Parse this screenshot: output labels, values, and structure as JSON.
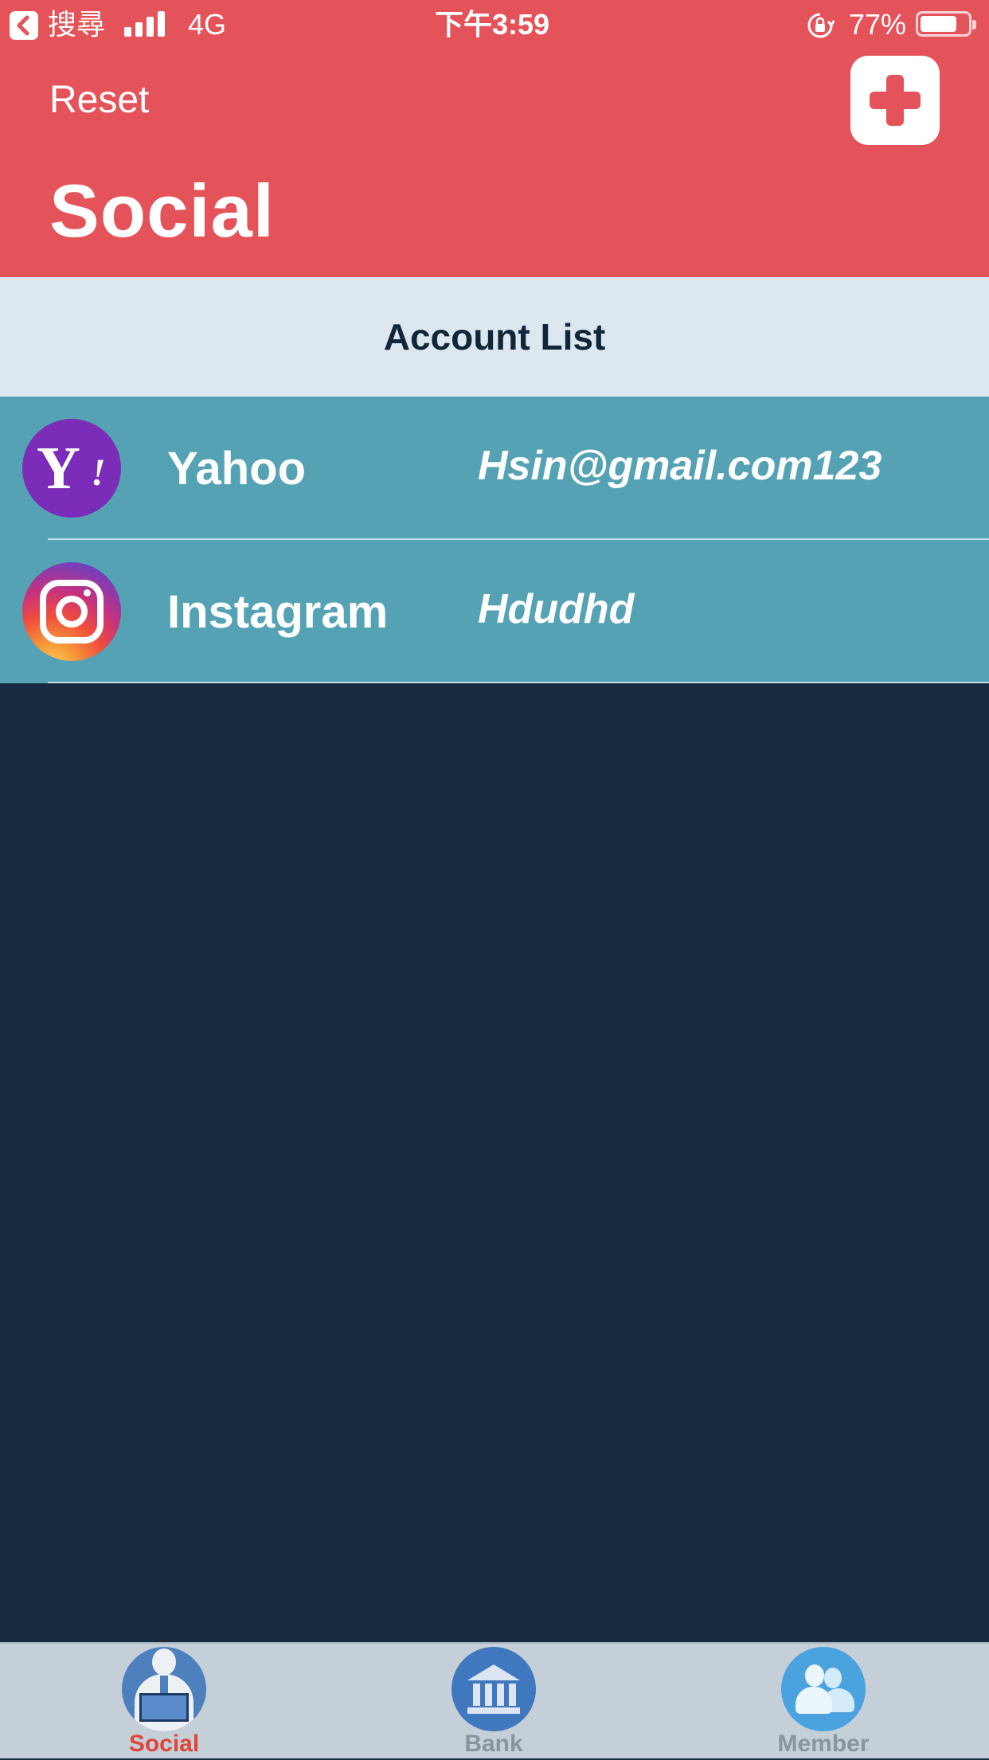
{
  "status_bar": {
    "back_app": "搜尋",
    "network": "4G",
    "time": "下午3:59",
    "battery": "77%",
    "battery_level": 0.77
  },
  "header": {
    "reset_label": "Reset",
    "title": "Social",
    "add_icon": "plus-icon",
    "color": "#e5535a"
  },
  "section": {
    "title": "Account List"
  },
  "accounts": [
    {
      "name": "Yahoo",
      "username": "Hsin@gmail.com123",
      "icon": "yahoo-logo-icon"
    },
    {
      "name": "Instagram",
      "username": "Hdudhd",
      "icon": "instagram-logo-icon"
    }
  ],
  "tabs": [
    {
      "label": "Social",
      "icon": "social-tab-icon",
      "active": true
    },
    {
      "label": "Bank",
      "icon": "bank-tab-icon",
      "active": false
    },
    {
      "label": "Member",
      "icon": "member-tab-icon",
      "active": false
    }
  ],
  "colors": {
    "header": "#e5535a",
    "section_header": "#dde7f0",
    "row": "#55a2b5",
    "background": "#172a40",
    "tab_bar": "#c4cfd8",
    "active_tab": "#e0453b",
    "inactive_tab": "#8a949d"
  }
}
